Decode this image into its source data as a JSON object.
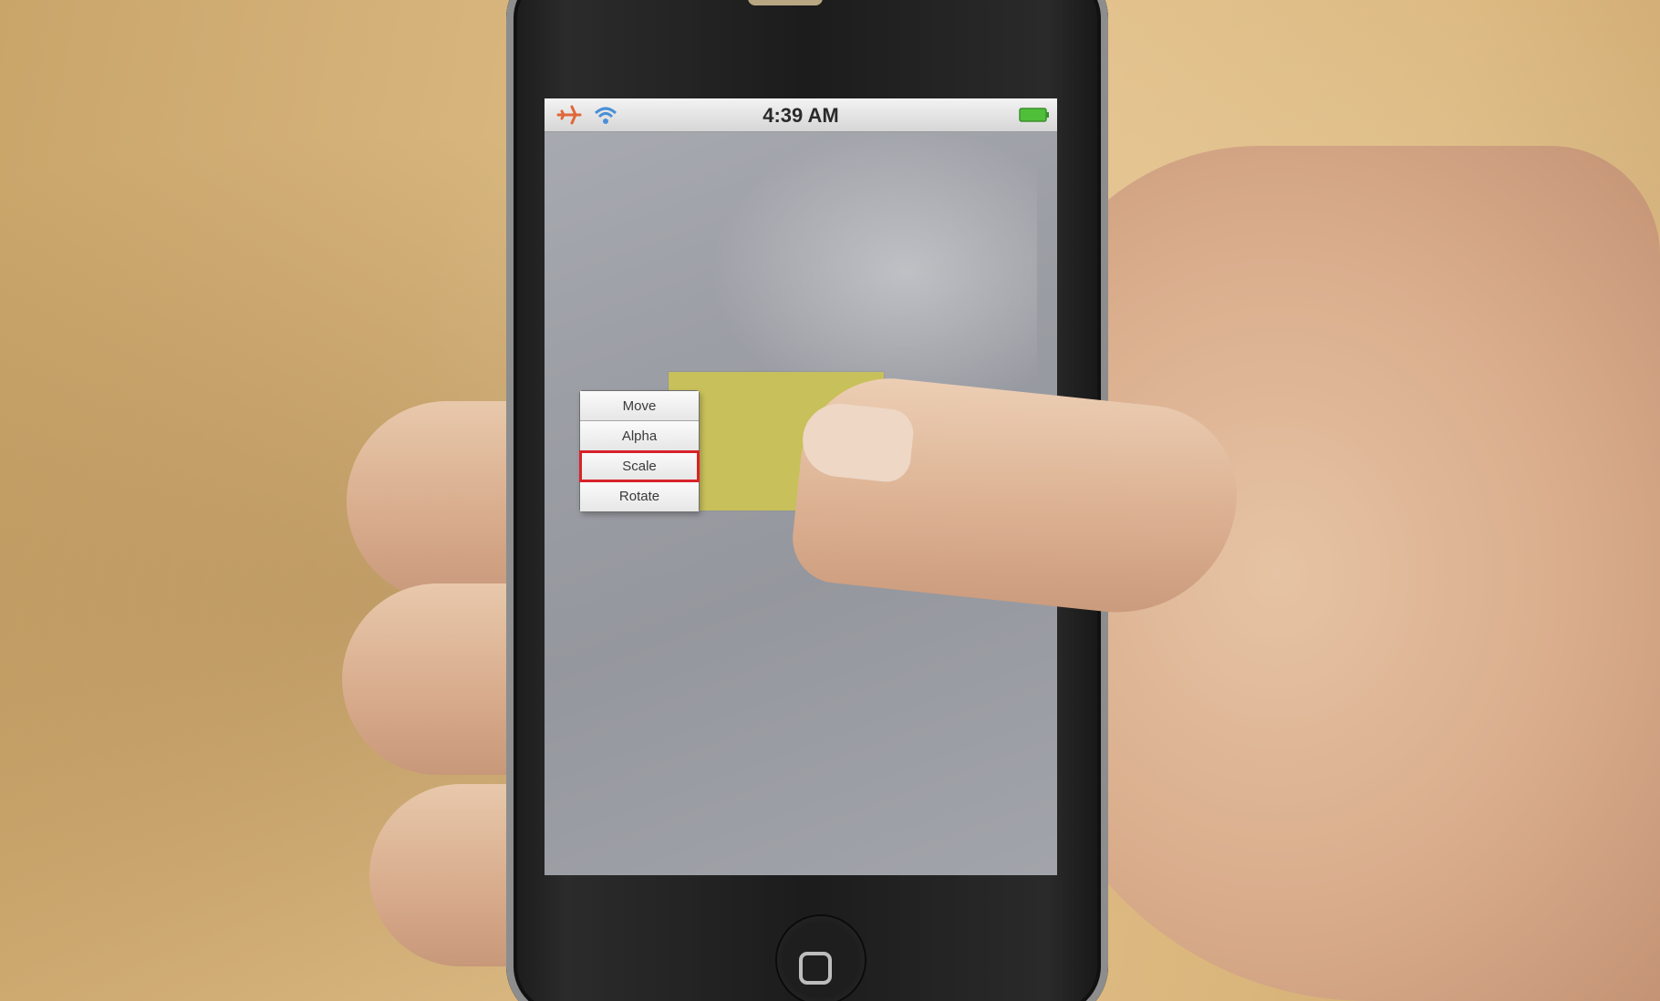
{
  "status_bar": {
    "time": "4:39 AM",
    "left_icons": [
      "airplane-icon",
      "wifi-icon"
    ],
    "right_icons": [
      "battery-icon"
    ]
  },
  "menu": {
    "items": [
      {
        "label": "Move",
        "selected": false
      },
      {
        "label": "Alpha",
        "selected": false
      },
      {
        "label": "Scale",
        "selected": true
      },
      {
        "label": "Rotate",
        "selected": false
      }
    ],
    "highlight_color": "#d8232a"
  },
  "colors": {
    "target_rectangle": "#c8c05a",
    "screen_background": "#9fa1a8"
  }
}
